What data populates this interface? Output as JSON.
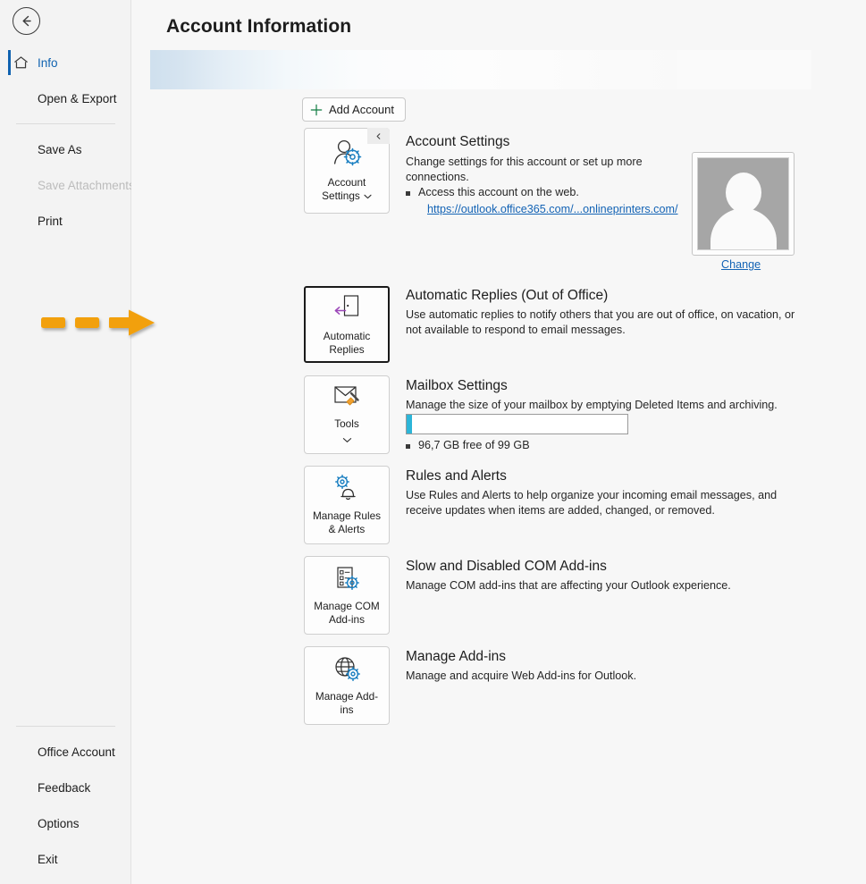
{
  "app": {
    "page_title": "Account Information",
    "back_icon": "back-arrow-icon"
  },
  "sidebar": {
    "top_items": [
      {
        "label": "Info",
        "icon": "home-icon",
        "state": "active"
      },
      {
        "label": "Open & Export",
        "icon": "",
        "state": "normal"
      }
    ],
    "mid_items": [
      {
        "label": "Save As",
        "state": "normal"
      },
      {
        "label": "Save Attachments",
        "state": "disabled"
      },
      {
        "label": "Print",
        "state": "normal"
      }
    ],
    "bottom_items": [
      {
        "label": "Office Account"
      },
      {
        "label": "Feedback"
      },
      {
        "label": "Options"
      },
      {
        "label": "Exit"
      }
    ]
  },
  "toolbar": {
    "add_account_label": "Add Account",
    "add_account_icon": "plus-icon"
  },
  "sections": [
    {
      "id": "account-settings",
      "button_label": "Account\nSettings",
      "button_label_line1": "Account",
      "button_label_line2": "Settings",
      "button_icon": "user-gear-icon",
      "has_caret": true,
      "has_collapse_tab": true,
      "collapse_icon": "chevron-left-icon",
      "title": "Account Settings",
      "description": "Change settings for this account or set up more connections.",
      "bullet": "Access this account on the web.",
      "link": "https://outlook.office365.com/...onlineprinters.com/"
    },
    {
      "id": "automatic-replies",
      "button_label_line1": "Automatic",
      "button_label_line2": "Replies",
      "button_icon": "out-of-office-door-icon",
      "focused": true,
      "title": "Automatic Replies (Out of Office)",
      "description": "Use automatic replies to notify others that you are out of office, on vacation, or not available to respond to email messages."
    },
    {
      "id": "mailbox-settings",
      "button_label_line1": "Tools",
      "button_label_line2": "",
      "button_icon": "mailbox-cleanup-icon",
      "has_caret": true,
      "title": "Mailbox Settings",
      "description": "Manage the size of your mailbox by emptying Deleted Items and archiving.",
      "storage_bullet": "96,7 GB free of 99 GB",
      "storage_percent": 2.4
    },
    {
      "id": "rules-and-alerts",
      "button_label_line1": "Manage Rules",
      "button_label_line2": "& Alerts",
      "button_icon": "rules-bell-gear-icon",
      "title": "Rules and Alerts",
      "description": "Use Rules and Alerts to help organize your incoming email messages, and receive updates when items are added, changed, or removed."
    },
    {
      "id": "com-addins",
      "button_label_line1": "Manage COM",
      "button_label_line2": "Add-ins",
      "button_icon": "com-addins-icon",
      "title": "Slow and Disabled COM Add-ins",
      "description": "Manage COM add-ins that are affecting your Outlook experience."
    },
    {
      "id": "manage-addins",
      "button_label_line1": "Manage Add-",
      "button_label_line2": "ins",
      "button_icon": "globe-gear-icon",
      "title": "Manage Add-ins",
      "description": "Manage and acquire Web Add-ins for Outlook."
    }
  ],
  "annotation": {
    "type": "dashed-arrow",
    "points_to": "automatic-replies-button",
    "color": "#F2A007"
  },
  "colors": {
    "accent_blue": "#0f62b0",
    "link_blue": "#1363b5",
    "storage_fill": "#2cb5d8",
    "annotation_orange": "#F2A007",
    "sidebar_bg": "#f3f3f3",
    "main_bg": "#f7f7f7"
  }
}
